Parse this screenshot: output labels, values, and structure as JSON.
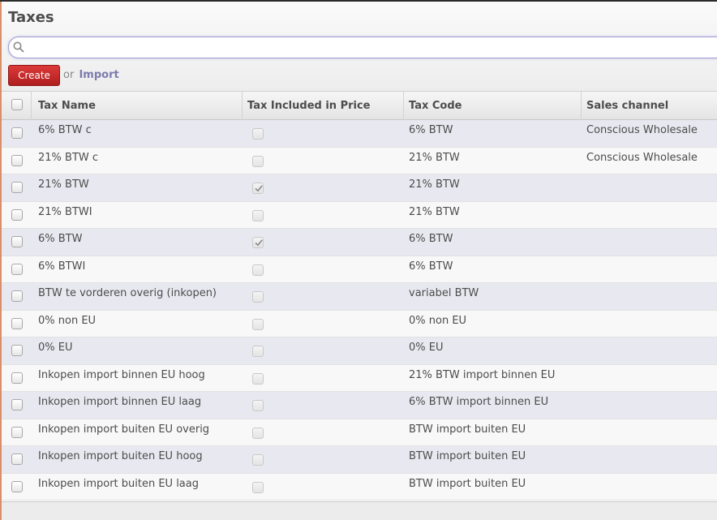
{
  "header": {
    "title": "Taxes",
    "search": {
      "value": "",
      "placeholder": ""
    },
    "create_label": "Create",
    "or_label": "or",
    "import_label": "Import"
  },
  "columns": {
    "tax_name": "Tax Name",
    "tax_included": "Tax Included in Price",
    "tax_code": "Tax Code",
    "sales_channel": "Sales channel"
  },
  "rows": [
    {
      "name": "6% BTW c",
      "included": false,
      "code": "6% BTW",
      "channel": "Conscious Wholesale"
    },
    {
      "name": "21% BTW c",
      "included": false,
      "code": "21% BTW",
      "channel": "Conscious Wholesale"
    },
    {
      "name": "21% BTW",
      "included": true,
      "code": "21% BTW",
      "channel": ""
    },
    {
      "name": "21% BTWI",
      "included": false,
      "code": "21% BTW",
      "channel": ""
    },
    {
      "name": "6% BTW",
      "included": true,
      "code": "6% BTW",
      "channel": ""
    },
    {
      "name": "6% BTWI",
      "included": false,
      "code": "6% BTW",
      "channel": ""
    },
    {
      "name": "BTW te vorderen overig (inkopen)",
      "included": false,
      "code": "variabel BTW",
      "channel": ""
    },
    {
      "name": "0% non EU",
      "included": false,
      "code": "0% non EU",
      "channel": ""
    },
    {
      "name": "0% EU",
      "included": false,
      "code": "0% EU",
      "channel": ""
    },
    {
      "name": "Inkopen import binnen EU hoog",
      "included": false,
      "code": "21% BTW import binnen EU",
      "channel": ""
    },
    {
      "name": "Inkopen import binnen EU laag",
      "included": false,
      "code": "6% BTW import binnen EU",
      "channel": ""
    },
    {
      "name": "Inkopen import buiten EU overig",
      "included": false,
      "code": "BTW import buiten EU",
      "channel": ""
    },
    {
      "name": "Inkopen import buiten EU hoog",
      "included": false,
      "code": "BTW import buiten EU",
      "channel": ""
    },
    {
      "name": "Inkopen import buiten EU laag",
      "included": false,
      "code": "BTW import buiten EU",
      "channel": ""
    }
  ],
  "colors": {
    "create_button": "#c0272d",
    "import_link": "#7c7bad",
    "row_alt": "#e8e8f0",
    "row_plain": "#f8f8f8",
    "search_border": "#9f9cd4"
  },
  "icons": {
    "search": "search-icon",
    "checked": "checkmark-icon"
  }
}
